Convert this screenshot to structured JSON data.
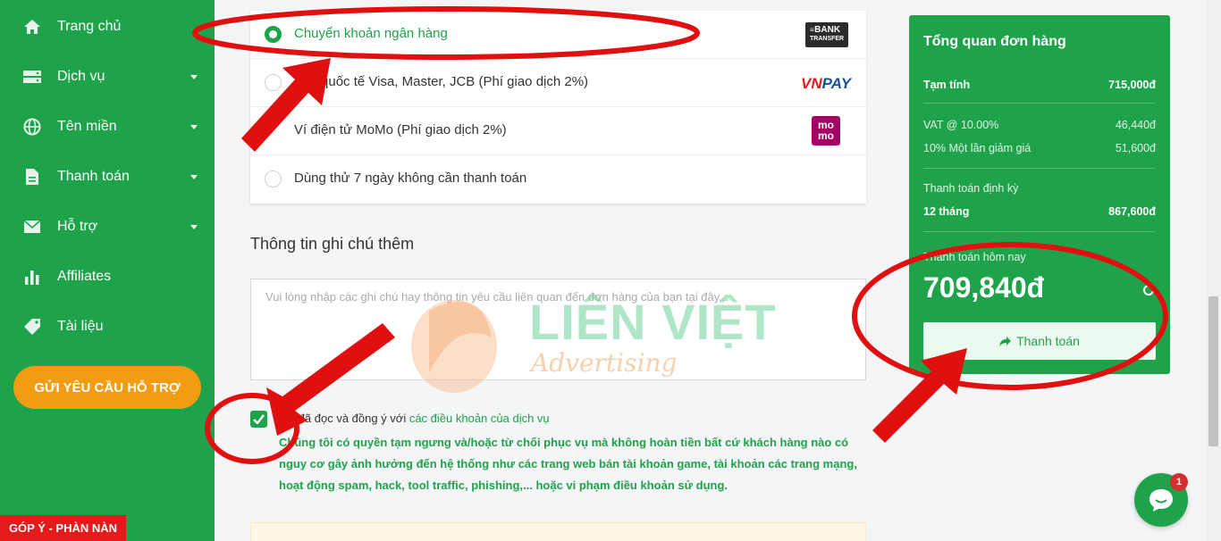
{
  "sidebar": {
    "items": [
      {
        "label": "Trang chủ",
        "icon": "home-icon",
        "has_caret": false
      },
      {
        "label": "Dịch vụ",
        "icon": "server-icon",
        "has_caret": true
      },
      {
        "label": "Tên miền",
        "icon": "globe-icon",
        "has_caret": true
      },
      {
        "label": "Thanh toán",
        "icon": "document-icon",
        "has_caret": true
      },
      {
        "label": "Hỗ trợ",
        "icon": "envelope-icon",
        "has_caret": true
      },
      {
        "label": "Affiliates",
        "icon": "bar-chart-icon",
        "has_caret": false
      },
      {
        "label": "Tài liệu",
        "icon": "tag-icon",
        "has_caret": false
      }
    ],
    "support_button": "GỬI YÊU CẦU HỖ TRỢ",
    "feedback_tab": "GÓP Ý - PHÀN NÀN"
  },
  "payment_methods": [
    {
      "label": "Chuyển khoản ngân hàng",
      "selected": true,
      "logo": "BANK TRANSFER"
    },
    {
      "label": "Thẻ quốc tế Visa, Master, JCB (Phí giao dịch 2%)",
      "selected": false,
      "logo": "VNPAY"
    },
    {
      "label": "Ví điện tử MoMo (Phí giao dịch 2%)",
      "selected": false,
      "logo": "momo"
    },
    {
      "label": "Dùng thử 7 ngày không cần thanh toán",
      "selected": false,
      "logo": ""
    }
  ],
  "logos": {
    "bank_line1": "BANK",
    "bank_line2": "TRANSFER",
    "vnpay_vn": "VN",
    "vnpay_pay": "PAY",
    "momo_top": "mo",
    "momo_bottom": "mo"
  },
  "notes": {
    "title": "Thông tin ghi chú thêm",
    "placeholder": "Vui lòng nhập các ghi chú hay thông tin yêu cầu liên quan đến đơn hàng của bạn tại đây..."
  },
  "agreement": {
    "checked": true,
    "prefix": "Tôi đã đọc và đồng ý với ",
    "link": "các điều khoản của dịch vụ",
    "policy": "Chúng tôi có quyền tạm ngưng và/hoặc từ chối phục vụ mà không hoàn tiền bất cứ khách hàng nào có nguy cơ gây ảnh hưởng đến hệ thống như các trang web bán tài khoản game, tài khoản các trang mạng, hoạt động spam, hack, tool traffic, phishing,... hoặc vi phạm điều khoản sử dụng."
  },
  "watermark": {
    "line1": "LIÊN VIỆT",
    "line2": "Advertising"
  },
  "summary": {
    "title": "Tổng quan đơn hàng",
    "subtotal_label": "Tạm tính",
    "subtotal_value": "715,000đ",
    "vat_label": "VAT @ 10.00%",
    "vat_value": "46,440đ",
    "discount_label": "10% Một lần giảm giá",
    "discount_value": "51,600đ",
    "recurring_label": "Thanh toán định kỳ",
    "recurring_period": "12 tháng",
    "recurring_value": "867,600đ",
    "today_label": "Thanh toán hôm nay",
    "today_total": "709,840đ",
    "checkout_label": "Thanh toán"
  },
  "chat": {
    "badge": "1"
  },
  "colors": {
    "brand_green": "#1ea34a",
    "orange": "#f39c12",
    "red": "#e31b1b",
    "annotation": "#e01010"
  }
}
